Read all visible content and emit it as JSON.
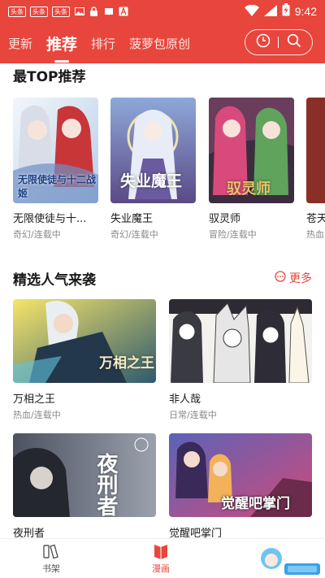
{
  "status_bar": {
    "left_badges": [
      "头条",
      "头条",
      "头条"
    ],
    "time": "9:42"
  },
  "top_nav": {
    "tabs": [
      {
        "label": "更新",
        "active": false
      },
      {
        "label": "推荐",
        "active": true
      },
      {
        "label": "排行",
        "active": false
      },
      {
        "label": "菠萝包原创",
        "active": false
      }
    ],
    "history_icon": "clock-icon",
    "search_icon": "search-icon",
    "accent_color": "#e8453c"
  },
  "top_section": {
    "title": "最TOP推荐",
    "items": [
      {
        "title": "无限使徒与十...",
        "meta": "奇幻/连载中",
        "cover_caption": "无限使徒与十二战姬"
      },
      {
        "title": "失业魔王",
        "meta": "奇幻/连载中",
        "cover_caption": "失业魔王"
      },
      {
        "title": "驭灵师",
        "meta": "冒险/连载中",
        "cover_caption": "驭灵师"
      },
      {
        "title": "苍天",
        "meta": "热血",
        "cover_caption": ""
      }
    ]
  },
  "popular_section": {
    "title": "精选人气来袭",
    "more_label": "更多",
    "items": [
      {
        "title": "万相之王",
        "meta": "热血/连载中",
        "cover_caption": "万相之王"
      },
      {
        "title": "非人哉",
        "meta": "日常/连载中",
        "cover_caption": ""
      },
      {
        "title": "夜刑者",
        "meta": "",
        "cover_caption": "夜刑者"
      },
      {
        "title": "觉醒吧掌门",
        "meta": "",
        "cover_caption": "觉醒吧掌门"
      }
    ]
  },
  "bottom_nav": {
    "items": [
      {
        "label": "书架",
        "active": false
      },
      {
        "label": "漫画",
        "active": true
      }
    ]
  }
}
